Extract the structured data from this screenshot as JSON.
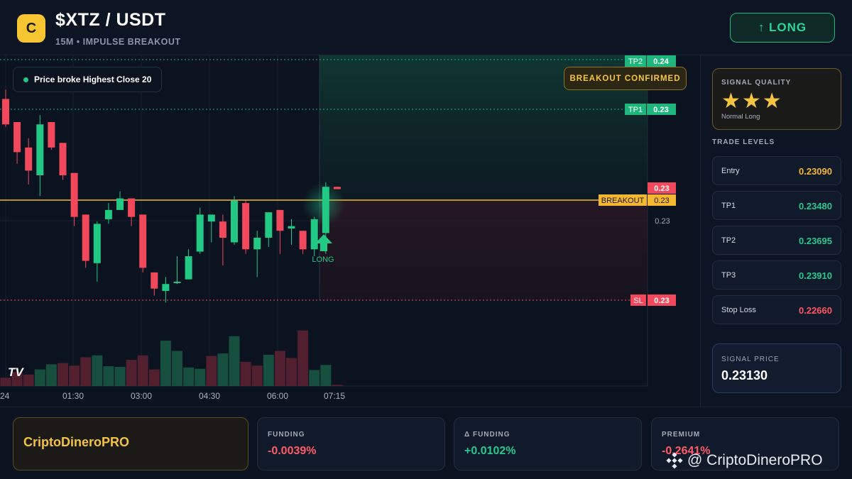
{
  "header": {
    "logo_letter": "C",
    "pair": "$XTZ / USDT",
    "subtitle": "15M • IMPULSE BREAKOUT",
    "long_button": "↑ LONG"
  },
  "chart": {
    "legend_text": "Price broke Highest Close 20",
    "breakout_badge": "BREAKOUT CONFIRMED",
    "long_marker_label": "LONG",
    "tv_logo": "TV",
    "price_tags": {
      "tp2_label": "TP2",
      "tp2_value": "0.24",
      "tp1_label": "TP1",
      "tp1_value": "0.23",
      "current_value": "0.23",
      "breakout_label": "BREAKOUT",
      "breakout_value": "0.23",
      "axis_value": "0.23",
      "sl_label": "SL",
      "sl_value": "0.23"
    },
    "time_labels": [
      "24",
      "01:30",
      "03:00",
      "04:30",
      "06:00",
      "07:15"
    ]
  },
  "chart_data": {
    "type": "candlestick",
    "interval": "15M",
    "ylim": [
      0.2266,
      0.237
    ],
    "levels": {
      "tp2": 0.237,
      "tp1": 0.2348,
      "breakout": 0.2313,
      "entry": 0.2309,
      "stop_loss": 0.2266
    },
    "candles": [
      {
        "o": 0.2353,
        "h": 0.2357,
        "l": 0.2341,
        "c": 0.2342
      },
      {
        "o": 0.2343,
        "h": 0.2343,
        "l": 0.2325,
        "c": 0.233
      },
      {
        "o": 0.2332,
        "h": 0.2336,
        "l": 0.2316,
        "c": 0.2322
      },
      {
        "o": 0.232,
        "h": 0.2346,
        "l": 0.2311,
        "c": 0.2342
      },
      {
        "o": 0.2343,
        "h": 0.2343,
        "l": 0.2331,
        "c": 0.2332
      },
      {
        "o": 0.2334,
        "h": 0.2334,
        "l": 0.2318,
        "c": 0.232
      },
      {
        "o": 0.2321,
        "h": 0.2321,
        "l": 0.2298,
        "c": 0.2302
      },
      {
        "o": 0.2303,
        "h": 0.2303,
        "l": 0.228,
        "c": 0.2283
      },
      {
        "o": 0.2282,
        "h": 0.23,
        "l": 0.2274,
        "c": 0.2299
      },
      {
        "o": 0.2301,
        "h": 0.2308,
        "l": 0.2299,
        "c": 0.2305
      },
      {
        "o": 0.2305,
        "h": 0.2313,
        "l": 0.2305,
        "c": 0.231
      },
      {
        "o": 0.231,
        "h": 0.231,
        "l": 0.2298,
        "c": 0.2302
      },
      {
        "o": 0.2303,
        "h": 0.2303,
        "l": 0.2278,
        "c": 0.228
      },
      {
        "o": 0.2278,
        "h": 0.2278,
        "l": 0.2268,
        "c": 0.2271
      },
      {
        "o": 0.227,
        "h": 0.2276,
        "l": 0.2265,
        "c": 0.2273
      },
      {
        "o": 0.2274,
        "h": 0.2285,
        "l": 0.2273,
        "c": 0.2274
      },
      {
        "o": 0.2275,
        "h": 0.2288,
        "l": 0.2275,
        "c": 0.2285
      },
      {
        "o": 0.2287,
        "h": 0.2306,
        "l": 0.2286,
        "c": 0.2303
      },
      {
        "o": 0.23,
        "h": 0.2303,
        "l": 0.2291,
        "c": 0.2303
      },
      {
        "o": 0.23,
        "h": 0.2303,
        "l": 0.2281,
        "c": 0.2293
      },
      {
        "o": 0.2291,
        "h": 0.2311,
        "l": 0.229,
        "c": 0.2309
      },
      {
        "o": 0.2308,
        "h": 0.2309,
        "l": 0.2286,
        "c": 0.2288
      },
      {
        "o": 0.2288,
        "h": 0.2296,
        "l": 0.2276,
        "c": 0.2293
      },
      {
        "o": 0.2293,
        "h": 0.2304,
        "l": 0.2289,
        "c": 0.2304
      },
      {
        "o": 0.2305,
        "h": 0.2305,
        "l": 0.2286,
        "c": 0.2296
      },
      {
        "o": 0.2297,
        "h": 0.2301,
        "l": 0.229,
        "c": 0.2298
      },
      {
        "o": 0.2296,
        "h": 0.2296,
        "l": 0.2286,
        "c": 0.2288
      },
      {
        "o": 0.2288,
        "h": 0.2302,
        "l": 0.2285,
        "c": 0.2301
      },
      {
        "o": 0.2295,
        "h": 0.2317,
        "l": 0.2286,
        "c": 0.2315
      },
      {
        "o": 0.2315,
        "h": 0.2315,
        "l": 0.2314,
        "c": 0.2314
      }
    ],
    "volume": [
      {
        "v": 0.13,
        "dir": "down"
      },
      {
        "v": 0.22,
        "dir": "down"
      },
      {
        "v": 0.18,
        "dir": "down"
      },
      {
        "v": 0.26,
        "dir": "up"
      },
      {
        "v": 0.34,
        "dir": "up"
      },
      {
        "v": 0.36,
        "dir": "down"
      },
      {
        "v": 0.32,
        "dir": "down"
      },
      {
        "v": 0.45,
        "dir": "down"
      },
      {
        "v": 0.48,
        "dir": "up"
      },
      {
        "v": 0.31,
        "dir": "up"
      },
      {
        "v": 0.3,
        "dir": "up"
      },
      {
        "v": 0.41,
        "dir": "down"
      },
      {
        "v": 0.48,
        "dir": "down"
      },
      {
        "v": 0.26,
        "dir": "down"
      },
      {
        "v": 0.71,
        "dir": "up"
      },
      {
        "v": 0.55,
        "dir": "up"
      },
      {
        "v": 0.29,
        "dir": "up"
      },
      {
        "v": 0.27,
        "dir": "up"
      },
      {
        "v": 0.47,
        "dir": "down"
      },
      {
        "v": 0.51,
        "dir": "up"
      },
      {
        "v": 0.78,
        "dir": "up"
      },
      {
        "v": 0.38,
        "dir": "down"
      },
      {
        "v": 0.32,
        "dir": "down"
      },
      {
        "v": 0.49,
        "dir": "up"
      },
      {
        "v": 0.55,
        "dir": "down"
      },
      {
        "v": 0.44,
        "dir": "down"
      },
      {
        "v": 0.87,
        "dir": "down"
      },
      {
        "v": 0.25,
        "dir": "up"
      },
      {
        "v": 0.33,
        "dir": "up"
      },
      {
        "v": 0.02,
        "dir": "down"
      }
    ]
  },
  "panel": {
    "quality_label": "SIGNAL QUALITY",
    "stars": "★★★",
    "quality_sub": "Normal Long",
    "levels_title": "TRADE LEVELS",
    "levels": [
      {
        "label": "Entry",
        "value": "0.23090",
        "color": "#f5b731"
      },
      {
        "label": "TP1",
        "value": "0.23480",
        "color": "#26c98e"
      },
      {
        "label": "TP2",
        "value": "0.23695",
        "color": "#26c98e"
      },
      {
        "label": "TP3",
        "value": "0.23910",
        "color": "#26c98e"
      },
      {
        "label": "Stop Loss",
        "value": "0.22660",
        "color": "#ff5566"
      }
    ],
    "signal_price_label": "SIGNAL PRICE",
    "signal_price": "0.23130"
  },
  "bottom": {
    "brand": "CriptoDineroPRO",
    "stats": [
      {
        "label": "FUNDING",
        "value": "-0.0039%",
        "color": "#ff5a6a"
      },
      {
        "label": "Δ FUNDING",
        "value": "+0.0102%",
        "color": "#26c98e"
      },
      {
        "label": "PREMIUM",
        "value": "-0.2641%",
        "color": "#ff5a6a"
      }
    ],
    "watermark": "@ CriptoDineroPRO"
  },
  "colors": {
    "bull": "#22c984",
    "bear": "#f2485c",
    "breakout": "#f5b731",
    "tp": "#1fb67d",
    "sl": "#f2485c"
  }
}
